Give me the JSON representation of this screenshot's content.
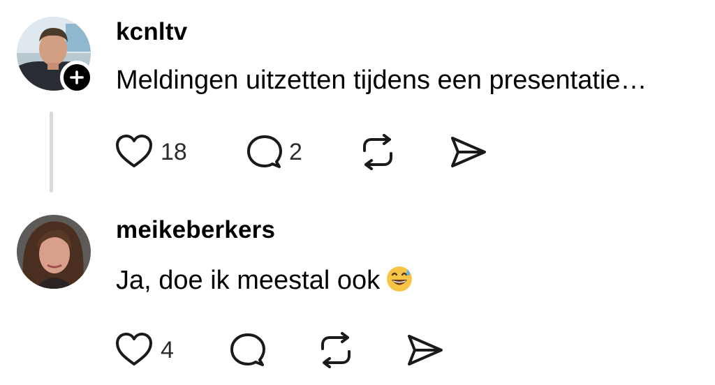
{
  "posts": [
    {
      "username": "kcnltv",
      "text": "Meldingen uitzetten tijdens een presentatie…",
      "likes": "18",
      "replies": "2"
    },
    {
      "username": "meikeberkers",
      "text": "Ja, doe ik meestal ook",
      "emoji": "sweat-smile-emoji",
      "likes": "4",
      "replies": ""
    }
  ],
  "icons": {
    "like": "heart-icon",
    "reply": "comment-bubble-icon",
    "repost": "repost-arrows-icon",
    "share": "send-icon",
    "follow": "plus-icon"
  },
  "colors": {
    "text": "#000000",
    "muted": "#2c2c2c",
    "thread_line": "#d9d9d9",
    "emoji_face": "#f7c545"
  }
}
